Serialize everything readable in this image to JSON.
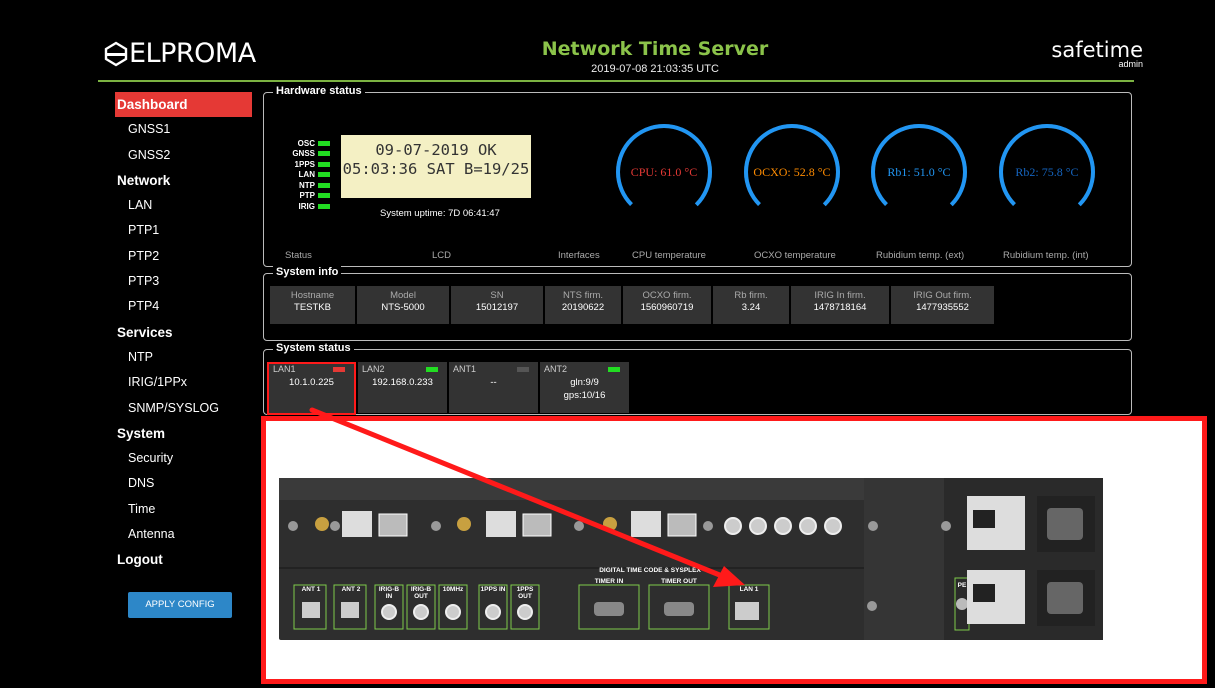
{
  "header": {
    "logo_text": "ELPROMA",
    "title": "Network Time Server",
    "datetime": "2019-07-08 21:03:35 UTC",
    "brand": "safetime",
    "user": "admin"
  },
  "sidebar": {
    "items": [
      {
        "label": "Dashboard",
        "kind": "head",
        "active": true
      },
      {
        "label": "GNSS1",
        "kind": "sub"
      },
      {
        "label": "GNSS2",
        "kind": "sub"
      },
      {
        "label": "Network",
        "kind": "head"
      },
      {
        "label": "LAN",
        "kind": "sub"
      },
      {
        "label": "PTP1",
        "kind": "sub"
      },
      {
        "label": "PTP2",
        "kind": "sub"
      },
      {
        "label": "PTP3",
        "kind": "sub"
      },
      {
        "label": "PTP4",
        "kind": "sub"
      },
      {
        "label": "Services",
        "kind": "head"
      },
      {
        "label": "NTP",
        "kind": "sub"
      },
      {
        "label": "IRIG/1PPx",
        "kind": "sub"
      },
      {
        "label": "SNMP/SYSLOG",
        "kind": "sub"
      },
      {
        "label": "System",
        "kind": "head"
      },
      {
        "label": "Security",
        "kind": "sub"
      },
      {
        "label": "DNS",
        "kind": "sub"
      },
      {
        "label": "Time",
        "kind": "sub"
      },
      {
        "label": "Antenna",
        "kind": "sub"
      },
      {
        "label": "Logout",
        "kind": "head"
      }
    ],
    "apply_label": "APPLY CONFIG"
  },
  "hardware": {
    "legend": "Hardware status",
    "leds": [
      "OSC",
      "GNSS",
      "1PPS",
      "LAN",
      "NTP",
      "PTP",
      "IRIG"
    ],
    "lcd_line1": "09-07-2019 OK",
    "lcd_line2": "05:03:36 SAT B=19/25",
    "uptime": "System uptime: 7D 06:41:47",
    "gauges": [
      {
        "text": "CPU: 61.0 °C",
        "color": "#e53935",
        "level": 0.75
      },
      {
        "text": "OCXO: 52.8 °C",
        "color": "#ff8c00",
        "level": 0.75
      },
      {
        "text": "Rb1: 51.0 °C",
        "color": "#2196f3",
        "level": 0.75
      },
      {
        "text": "Rb2: 75.8 °C",
        "color": "#1565c0",
        "level": 0.75
      }
    ],
    "labels": [
      "Status",
      "LCD",
      "Interfaces",
      "CPU temperature",
      "OCXO temperature",
      "Rubidium temp. (ext)",
      "Rubidium temp. (int)"
    ]
  },
  "system_info": {
    "legend": "System info",
    "cells": [
      {
        "key": "Hostname",
        "value": "TESTKB"
      },
      {
        "key": "Model",
        "value": "NTS-5000"
      },
      {
        "key": "SN",
        "value": "15012197"
      },
      {
        "key": "NTS firm.",
        "value": "20190622"
      },
      {
        "key": "OCXO firm.",
        "value": "1560960719"
      },
      {
        "key": "Rb firm.",
        "value": "3.24"
      },
      {
        "key": "IRIG In firm.",
        "value": "1478718164"
      },
      {
        "key": "IRIG Out firm.",
        "value": "1477935552"
      }
    ]
  },
  "system_status": {
    "legend": "System status",
    "cells": [
      {
        "key": "LAN1",
        "line1": "10.1.0.225",
        "line2": "",
        "led": "#e53935"
      },
      {
        "key": "LAN2",
        "line1": "192.168.0.233",
        "line2": "",
        "led": "#22dd22"
      },
      {
        "key": "ANT1",
        "line1": "--",
        "line2": "",
        "led": "#555555"
      },
      {
        "key": "ANT2",
        "line1": "gln:9/9",
        "line2": "gps:10/16",
        "led": "#22dd22"
      }
    ]
  },
  "device": {
    "ports_top": [
      "ANT 1",
      "ANT 2",
      "IRIG-B IN",
      "IRIG-B OUT",
      "10MHz",
      "1PPS IN",
      "1PPS OUT"
    ],
    "header_label": "DIGITAL TIME CODE & SYSPLEX",
    "timer_in": "TIMER IN",
    "timer_out": "TIMER OUT",
    "lan1": "LAN 1",
    "pe": "PE"
  }
}
